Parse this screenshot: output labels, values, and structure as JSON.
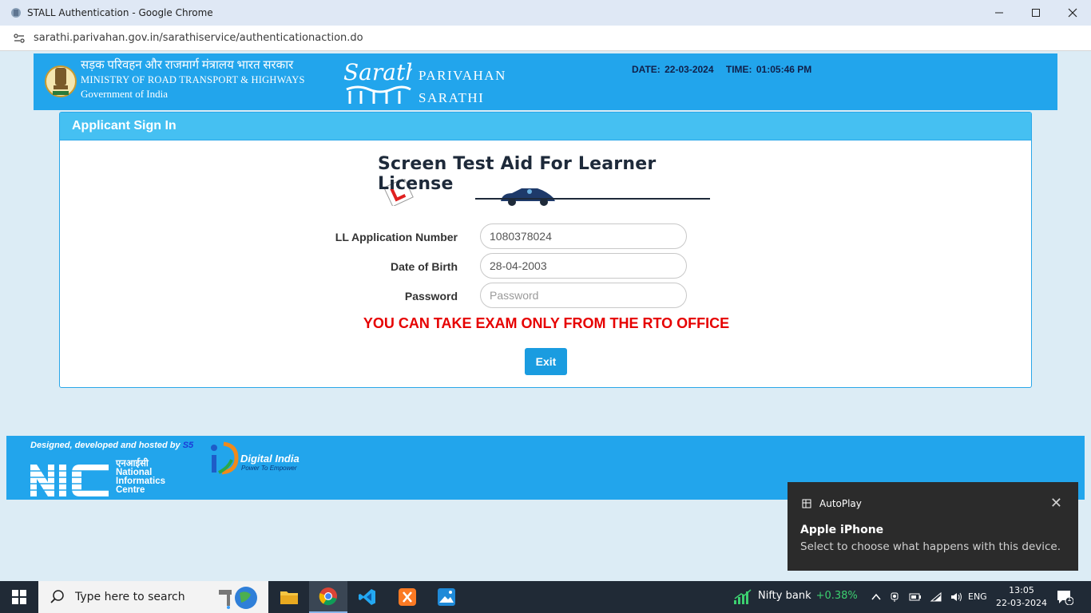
{
  "browser": {
    "window_title": "STALL Authentication - Google Chrome",
    "url": "sarathi.parivahan.gov.in/sarathiservice/authenticationaction.do"
  },
  "header": {
    "ministry_hindi": "सड़क परिवहन और राजमार्ग मंत्रालय भारत सरकार",
    "ministry_english": "MINISTRY OF ROAD TRANSPORT & HIGHWAYS",
    "government": "Government of India",
    "brand_line1": "PARIVAHAN",
    "brand_line2": "SARATHI",
    "date_label": "DATE:",
    "date_value": "22-03-2024",
    "time_label": "TIME:",
    "time_value": "01:05:46 PM"
  },
  "panel": {
    "title": "Applicant Sign In",
    "banner_title": "Screen Test Aid For Learner License",
    "fields": {
      "app_number_label": "LL Application Number",
      "app_number_value": "1080378024",
      "dob_label": "Date of Birth",
      "dob_value": "28-04-2003",
      "password_label": "Password",
      "password_placeholder": "Password"
    },
    "warning": "YOU CAN TAKE EXAM ONLY FROM THE RTO OFFICE",
    "exit_label": "Exit"
  },
  "footer": {
    "designed_by": "Designed, developed and hosted by",
    "designed_by_brand": "S5",
    "nic_hindi": "एनआईसी",
    "nic_line1": "National",
    "nic_line2": "Informatics",
    "nic_line3": "Centre",
    "digital_india": "Digital India",
    "digital_india_tagline": "Power To Empower"
  },
  "toast": {
    "app": "AutoPlay",
    "title": "Apple iPhone",
    "body": "Select to choose what happens with this device."
  },
  "taskbar": {
    "search_placeholder": "Type here to search",
    "nifty_label": "Nifty bank",
    "nifty_change": "+0.38%",
    "language": "ENG",
    "time": "13:05",
    "date": "22-03-2024",
    "notification_count": "1"
  },
  "colors": {
    "header_blue": "#22a5ec",
    "panel_head": "#45c0f2",
    "warning_red": "#e60000",
    "button_blue": "#1a9ce0"
  }
}
